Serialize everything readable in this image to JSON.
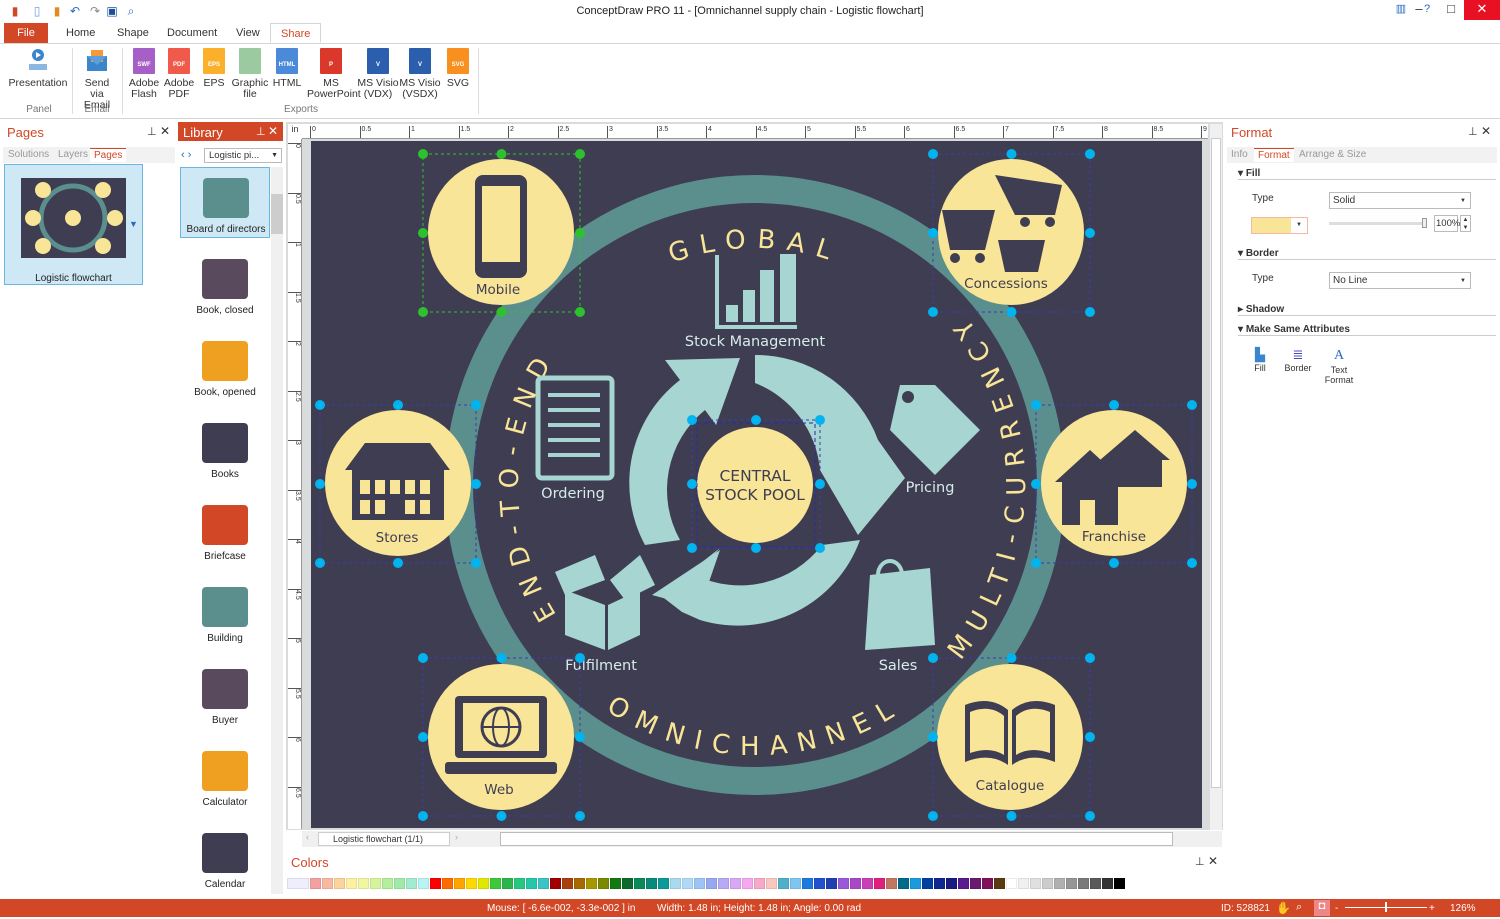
{
  "window": {
    "title": "ConceptDraw PRO 11 - [Omnichannel supply chain - Logistic flowchart]"
  },
  "ribbon": {
    "tabs": [
      {
        "label": "File"
      },
      {
        "label": "Home"
      },
      {
        "label": "Shape"
      },
      {
        "label": "Document"
      },
      {
        "label": "View"
      },
      {
        "label": "Share",
        "active": true
      }
    ],
    "buttons": [
      {
        "label": "Presentation",
        "icon": "presentation-icon"
      },
      {
        "label": "Send via Email",
        "icon": "email-icon"
      },
      {
        "label": "Adobe Flash",
        "icon": "swf-file-icon",
        "badge": "SWF",
        "color": "#a65fc7"
      },
      {
        "label": "Adobe PDF",
        "icon": "pdf-file-icon",
        "badge": "PDF",
        "color": "#f05a4a"
      },
      {
        "label": "EPS",
        "icon": "eps-file-icon",
        "badge": "EPS",
        "color": "#fbb02c"
      },
      {
        "label": "Graphic file",
        "icon": "image-file-icon",
        "badge": "",
        "color": "#9bc9a0"
      },
      {
        "label": "HTML",
        "icon": "html-file-icon",
        "badge": "HTML",
        "color": "#4a8ad8"
      },
      {
        "label": "MS PowerPoint",
        "icon": "powerpoint-icon",
        "badge": "P",
        "color": "#d9382b"
      },
      {
        "label": "MS Visio (VDX)",
        "icon": "visio-vdx-icon",
        "badge": "V",
        "color": "#2b5fad"
      },
      {
        "label": "MS Visio (VSDX)",
        "icon": "visio-vsdx-icon",
        "badge": "V",
        "color": "#2b5fad"
      },
      {
        "label": "SVG",
        "icon": "svg-file-icon",
        "badge": "SVG",
        "color": "#f7901e"
      }
    ],
    "groups": [
      "Panel",
      "Email",
      "Exports"
    ]
  },
  "pages_panel": {
    "title": "Pages",
    "tabs": [
      "Solutions",
      "Layers",
      "Pages"
    ],
    "active_tab": "Pages",
    "page": {
      "label": "Logistic flowchart"
    }
  },
  "library": {
    "title": "Library",
    "selector": "Logistic pi...",
    "items": [
      "Board of directors",
      "Book, closed",
      "Book, opened",
      "Books",
      "Briefcase",
      "Building",
      "Buyer",
      "Calculator",
      "Calendar"
    ],
    "selected": "Board of directors"
  },
  "ruler": {
    "unit": "in",
    "ticks": [
      "0",
      "0.5",
      "1",
      "1.5",
      "2",
      "2.5",
      "3",
      "3.5",
      "4",
      "4.5",
      "5",
      "5.5",
      "6",
      "6.5",
      "7",
      "7.5",
      "8",
      "8.5",
      "9"
    ]
  },
  "diagram": {
    "center": "CENTRAL\nSTOCK POOL",
    "center_lines": [
      "CENTRAL",
      "STOCK POOL"
    ],
    "ring_texts": {
      "top": "GLOBAL",
      "left": "END-TO-END",
      "right": "MULTI-CURRENCY",
      "bottom": "OMNICHANNEL"
    },
    "nodes": {
      "mobile": "Mobile",
      "concessions": "Concessions",
      "stores": "Stores",
      "franchise": "Franchise",
      "web": "Web",
      "catalogue": "Catalogue"
    },
    "labels": {
      "stock": "Stock Management",
      "ordering": "Ordering",
      "pricing": "Pricing",
      "fulfilment": "Fulfilment",
      "sales": "Sales"
    },
    "colors": {
      "background": "#3f3d52",
      "ring": "#5a8f8e",
      "circle": "#f9e597",
      "icon": "#a7d5d2",
      "text_dark": "#3f3d52"
    }
  },
  "page_tabs": {
    "current": "Logistic flowchart (1/1)"
  },
  "format_panel": {
    "title": "Format",
    "tabs": [
      "Info",
      "Format",
      "Arrange & Size"
    ],
    "active_tab": "Format",
    "fill": {
      "header": "Fill",
      "type_label": "Type",
      "type_value": "Solid",
      "color": "#f9e597",
      "opacity": "100%"
    },
    "border": {
      "header": "Border",
      "type_label": "Type",
      "type_value": "No Line"
    },
    "shadow": {
      "header": "Shadow"
    },
    "make_same": {
      "header": "Make Same Attributes",
      "buttons": [
        "Fill",
        "Border",
        "Text\nFormat"
      ],
      "b0": "Fill",
      "b1": "Border",
      "b2a": "Text",
      "b2b": "Format"
    }
  },
  "colors_panel": {
    "title": "Colors",
    "swatches": [
      "#f4a0a0",
      "#f9b9a0",
      "#fbd39c",
      "#fdf0a0",
      "#f1f7a0",
      "#d5f59c",
      "#b4f09c",
      "#a0eaa8",
      "#a0ecd0",
      "#b9f4f4",
      "#ff0000",
      "#ff6a00",
      "#ffa500",
      "#ffd800",
      "#e0e800",
      "#3cc93c",
      "#2bb64b",
      "#26c87e",
      "#25c7a9",
      "#3cc4c4",
      "#a00000",
      "#a8400e",
      "#a86a00",
      "#a89800",
      "#7a8a00",
      "#127a12",
      "#0c6a2a",
      "#0a8a5a",
      "#088a7a",
      "#0a9a9a",
      "#a8daf0",
      "#b0d8f8",
      "#9ec4f5",
      "#98a8f0",
      "#b8a8f5",
      "#d8a8f5",
      "#f5a8f0",
      "#f8a8c8",
      "#f8c8c0",
      "#4fb0c8",
      "#7ec6f0",
      "#1a7ae0",
      "#2250d0",
      "#2040b0",
      "#9a5ad8",
      "#a848c8",
      "#c840b8",
      "#e0207a",
      "#c07860",
      "#006a8a",
      "#1a9ae0",
      "#0040a0",
      "#102890",
      "#1a1a80",
      "#5a1a90",
      "#6a1a70",
      "#80105a",
      "#5a3a10",
      "#ffffff",
      "#f0f0f0",
      "#e0e0e0",
      "#cccccc",
      "#b0b0b0",
      "#969696",
      "#7a7a7a",
      "#5a5a5a",
      "#333333",
      "#000000"
    ]
  },
  "status": {
    "mouse": "Mouse: [ -6.6e-002, -3.3e-002 ] in",
    "size": "Width: 1.48 in;  Height: 1.48 in;  Angle: 0.00 rad",
    "id": "ID: 528821",
    "zoom": "126%"
  },
  "theme": {
    "accent": "#d24726"
  }
}
